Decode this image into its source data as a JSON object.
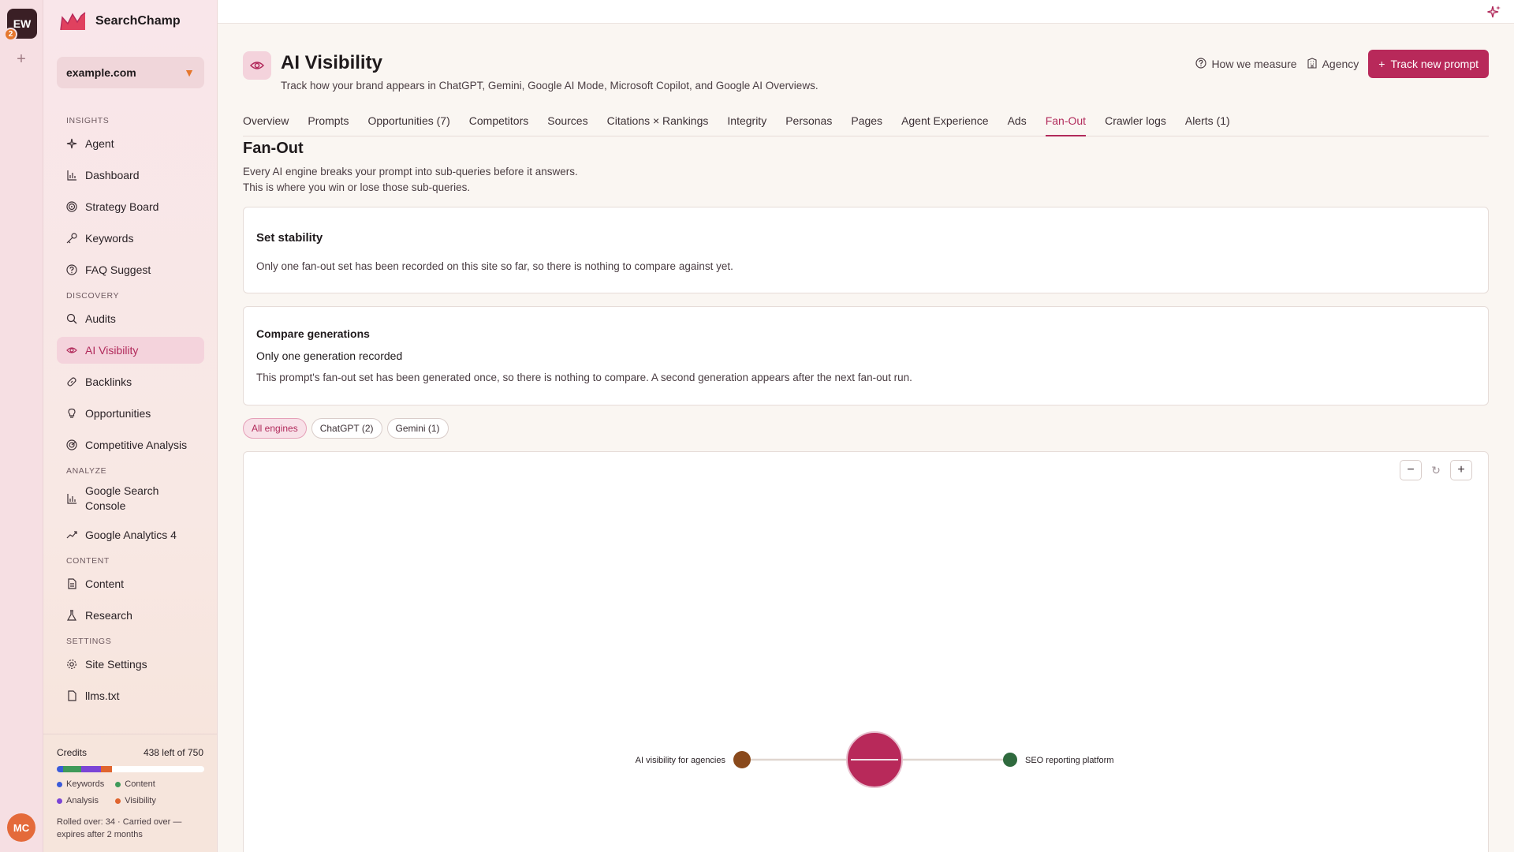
{
  "rail": {
    "workspace_initials": "EW",
    "workspace_count": "2",
    "add": "+",
    "user_initials": "MC"
  },
  "brand": {
    "name": "SearchChamp"
  },
  "site": {
    "domain": "example.com"
  },
  "sidebar": {
    "sections": {
      "insights": "INSIGHTS",
      "discovery": "DISCOVERY",
      "analyze": "ANALYZE",
      "content": "CONTENT",
      "settings": "SETTINGS"
    },
    "items": {
      "agent": "Agent",
      "dashboard": "Dashboard",
      "strategy_board": "Strategy Board",
      "keywords": "Keywords",
      "faq_suggest": "FAQ Suggest",
      "audits": "Audits",
      "ai_visibility": "AI Visibility",
      "backlinks": "Backlinks",
      "opportunities": "Opportunities",
      "competitive_analysis": "Competitive Analysis",
      "google_search_console": "Google Search Console",
      "google_analytics": "Google Analytics 4",
      "content": "Content",
      "research": "Research",
      "site_settings": "Site Settings",
      "llms_txt": "llms.txt"
    }
  },
  "credits": {
    "label": "Credits",
    "remaining": "438 left of 750",
    "used": 312,
    "total": 750,
    "breakdown": [
      {
        "name": "Keywords",
        "color": "#3b5bd9",
        "amount": 34
      },
      {
        "name": "Content",
        "color": "#3f9a5a",
        "amount": 90
      },
      {
        "name": "Analysis",
        "color": "#7b45d6",
        "amount": 100
      },
      {
        "name": "Visibility",
        "color": "#e0642e",
        "amount": 55
      }
    ],
    "rollover": "Rolled over: 34 · Carried over — expires after 2 months"
  },
  "header": {
    "title": "AI Visibility",
    "subtitle": "Track how your brand appears in ChatGPT, Gemini, Google AI Mode, Microsoft Copilot, and Google AI Overviews.",
    "how_we_measure": "How we measure",
    "agency": "Agency",
    "track_button": "Track new prompt"
  },
  "tabs": [
    "Overview",
    "Prompts",
    "Opportunities (7)",
    "Competitors",
    "Sources",
    "Citations × Rankings",
    "Integrity",
    "Personas",
    "Pages",
    "Agent Experience",
    "Ads",
    "Fan-Out",
    "Crawler logs",
    "Alerts (1)"
  ],
  "active_tab": "Fan-Out",
  "fanout": {
    "title": "Fan-Out",
    "desc_line1": "Every AI engine breaks your prompt into sub-queries before it answers.",
    "desc_line2": "This is where you win or lose those sub-queries."
  },
  "stability": {
    "title": "Set stability",
    "text": "Only one fan-out set has been recorded on this site so far, so there is nothing to compare against yet."
  },
  "compare": {
    "title": "Compare generations",
    "subtitle": "Only one generation recorded",
    "text": "This prompt's fan-out set has been generated once, so there is nothing to compare. A second generation appears after the next fan-out run."
  },
  "chips": [
    "All engines",
    "ChatGPT (2)",
    "Gemini (1)"
  ],
  "graph": {
    "zoom_out": "−",
    "reset": "↻",
    "zoom_in": "+",
    "nodes": {
      "left": {
        "label": "AI visibility for agencies",
        "color": "#8a4a1c"
      },
      "center": {
        "color": "#b8295a"
      },
      "right": {
        "label": "SEO reporting platform",
        "color": "#2f6a3e"
      }
    },
    "edge_color": "#e0d6cf"
  },
  "colors": {
    "accent": "#b8295a"
  }
}
